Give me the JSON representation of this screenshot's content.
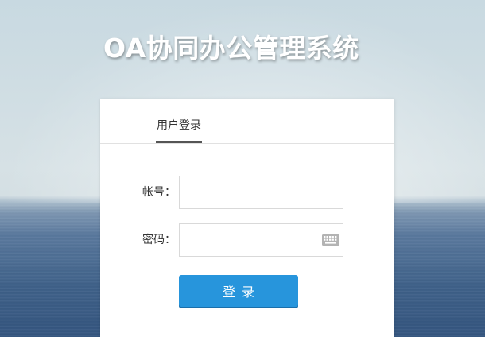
{
  "app": {
    "title": "OA协同办公管理系统"
  },
  "login": {
    "tab_label": "用户登录",
    "account_label": "帐号：",
    "account_value": "",
    "password_label": "密码：",
    "password_value": "",
    "keyboard_icon": "keyboard-icon",
    "submit_label": "登录"
  },
  "colors": {
    "accent": "#2795dc",
    "panel": "#ffffff",
    "text": "#333333"
  }
}
